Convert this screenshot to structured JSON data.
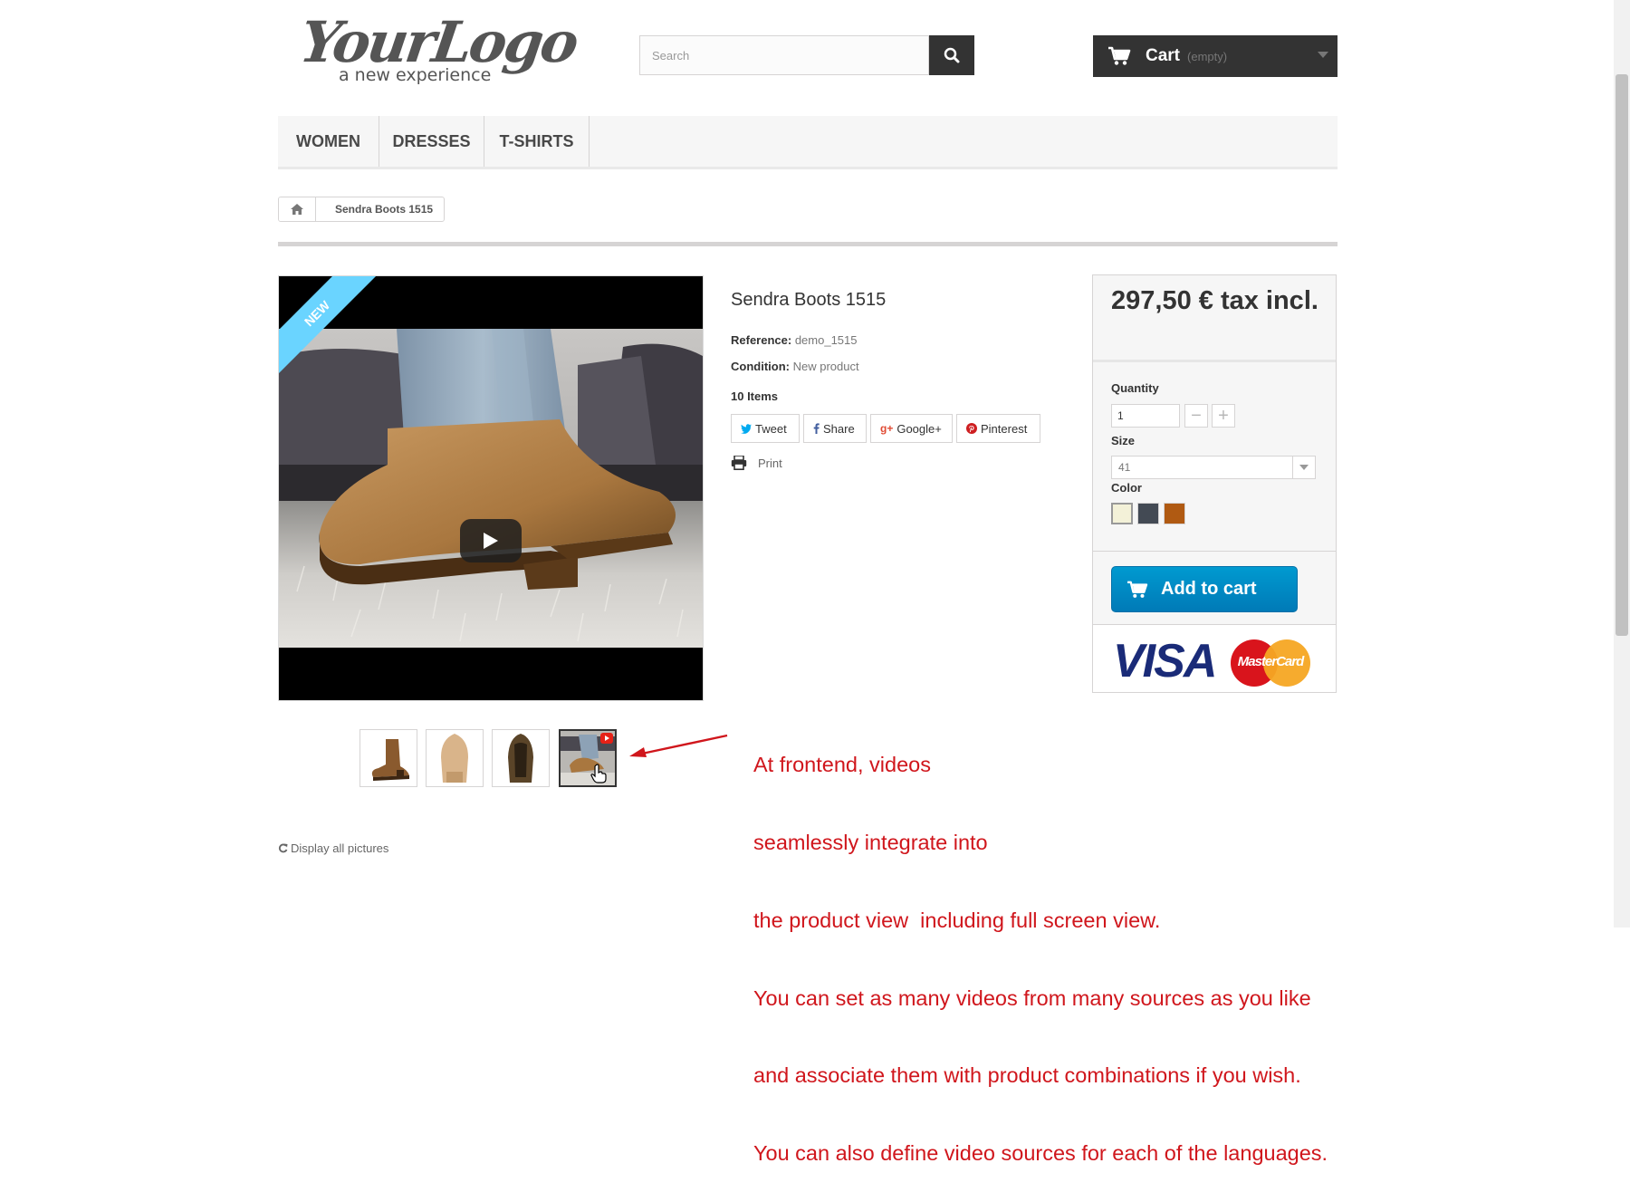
{
  "header": {
    "logo": {
      "main": "YourLogo",
      "tagline": "a new experience"
    },
    "search": {
      "placeholder": "Search",
      "icon": "search-icon"
    },
    "cart": {
      "label": "Cart",
      "status": "(empty)",
      "icon": "cart-icon"
    }
  },
  "menu": {
    "items": [
      "Women",
      "Dresses",
      "T-shirts"
    ]
  },
  "breadcrumb": {
    "home_icon": "home-icon",
    "current": "Sendra Boots 1515"
  },
  "product": {
    "badge": "New",
    "title": "Sendra Boots 1515",
    "reference_label": "Reference:",
    "reference_value": "demo_1515",
    "condition_label": "Condition:",
    "condition_value": "New product",
    "items_count": "10 Items",
    "social": {
      "tweet": "Tweet",
      "share": "Share",
      "googleplus": "Google+",
      "pinterest": "Pinterest"
    },
    "print": "Print",
    "display_all": "Display all pictures",
    "thumbnails": [
      "boot-side",
      "boot-sole",
      "boot-top",
      "video-thumbnail"
    ]
  },
  "buy_box": {
    "price": "297,50 € tax incl.",
    "quantity_label": "Quantity",
    "quantity_value": "1",
    "size_label": "Size",
    "size_value": "41",
    "color_label": "Color",
    "colors": [
      "#f3f1d8",
      "#434a54",
      "#b05a12"
    ],
    "add_to_cart": "Add to cart",
    "payment": {
      "visa": "VISA",
      "mastercard": "MasterCard"
    }
  },
  "annotation": {
    "lines": [
      "At frontend, videos",
      "seamlessly integrate into",
      "the product view  including full screen view.",
      "You can set as many videos from many sources as you like",
      "and associate them with product combinations if you wish.",
      "You can also define video sources for each of the languages."
    ]
  },
  "colors": {
    "accent": "#009ad0",
    "annotation": "#d0161c",
    "ribbon": "#6ad4ff"
  }
}
